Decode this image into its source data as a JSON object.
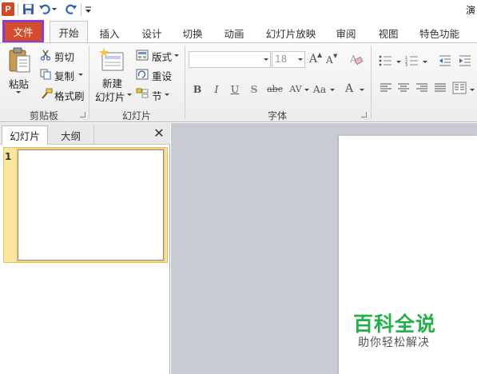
{
  "titlebar": {
    "app_icon": "P",
    "title": "演"
  },
  "tabs": [
    {
      "label": "文件"
    },
    {
      "label": "开始"
    },
    {
      "label": "插入"
    },
    {
      "label": "设计"
    },
    {
      "label": "切换"
    },
    {
      "label": "动画"
    },
    {
      "label": "幻灯片放映"
    },
    {
      "label": "审阅"
    },
    {
      "label": "视图"
    },
    {
      "label": "特色功能"
    }
  ],
  "ribbon": {
    "clipboard": {
      "paste": "粘贴",
      "cut": "剪切",
      "copy": "复制",
      "format_painter": "格式刷",
      "group": "剪贴板"
    },
    "slides": {
      "new_slide_line1": "新建",
      "new_slide_line2": "幻灯片",
      "layout": "版式",
      "reset": "重设",
      "section": "节",
      "group": "幻灯片"
    },
    "font": {
      "font_name": "",
      "font_size": "18",
      "bold": "B",
      "italic": "I",
      "underline": "U",
      "shadow": "S",
      "strike": "abc",
      "spacing": "AV",
      "case": "Aa",
      "color": "A",
      "grow": "A",
      "shrink": "A",
      "group": "字体"
    }
  },
  "left_panel": {
    "tab_slides": "幻灯片",
    "tab_outline": "大纲",
    "close": "✕",
    "slide_number": "1"
  },
  "watermark": {
    "title": "百科全说",
    "subtitle": "助你轻松解决"
  },
  "colors": {
    "file_tab": "#d64d2e",
    "file_tab_border": "#8e3bd6",
    "thumb_highlight": "#f9e79f",
    "workspace": "#c8cbd1",
    "watermark_green": "#23b04a"
  }
}
